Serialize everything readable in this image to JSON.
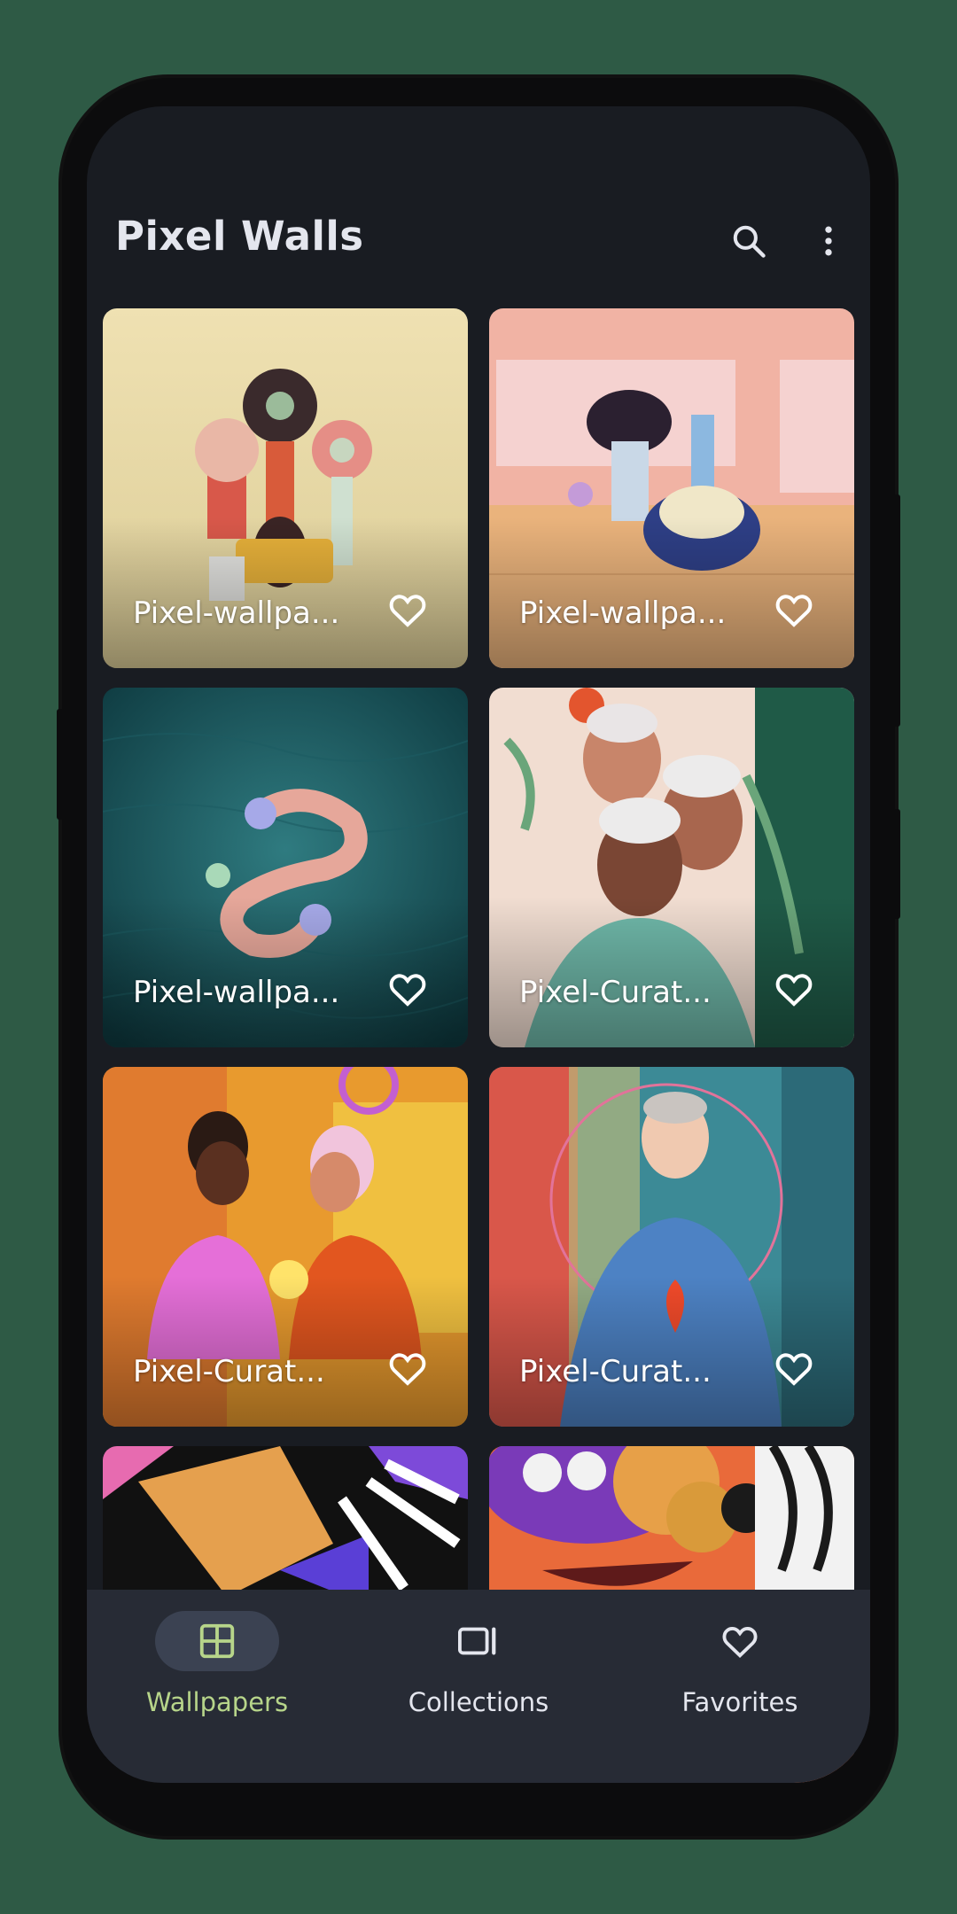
{
  "app": {
    "title": "Pixel Walls"
  },
  "header": {
    "search_icon": "search-icon",
    "more_icon": "more-vert-icon"
  },
  "colors": {
    "accent": "#b7d58a",
    "background": "#191c22",
    "nav_background": "#272b35",
    "text": "#e4e6ee"
  },
  "wallpapers": [
    {
      "label": "Pixel-wallpa...",
      "favorited": false
    },
    {
      "label": "Pixel-wallpa...",
      "favorited": false
    },
    {
      "label": "Pixel-wallpa...",
      "favorited": false
    },
    {
      "label": "Pixel-Curat...",
      "favorited": false
    },
    {
      "label": "Pixel-Curat...",
      "favorited": false
    },
    {
      "label": "Pixel-Curat...",
      "favorited": false
    }
  ],
  "nav": {
    "items": [
      {
        "label": "Wallpapers",
        "icon": "grid-icon",
        "active": true
      },
      {
        "label": "Collections",
        "icon": "collections-icon",
        "active": false
      },
      {
        "label": "Favorites",
        "icon": "heart-icon",
        "active": false
      }
    ]
  }
}
